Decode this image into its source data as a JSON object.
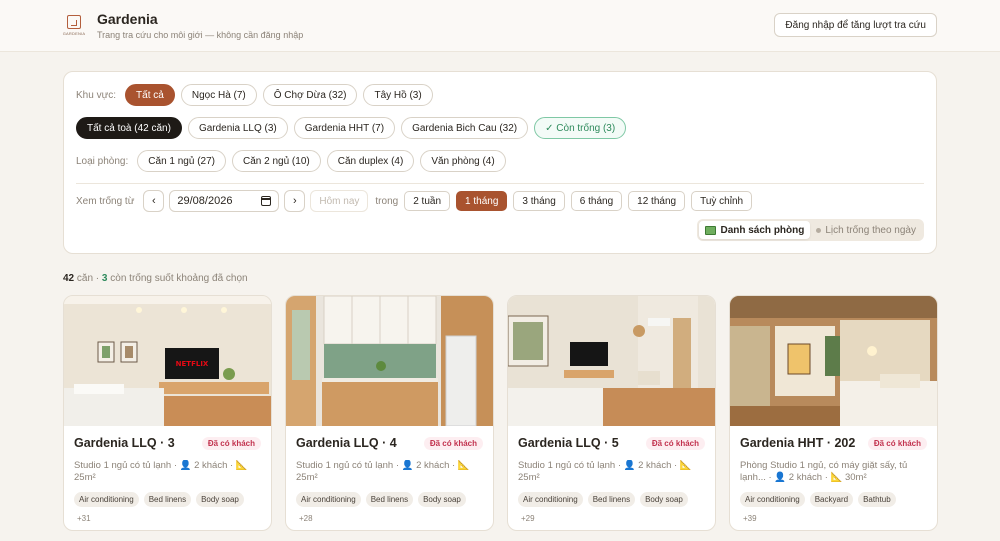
{
  "header": {
    "logo_text": "GARDENIA",
    "title": "Gardenia",
    "subtitle": "Trang tra cứu cho môi giới — không cần đăng nhập",
    "login_button": "Đăng nhập để tăng lượt tra cứu"
  },
  "filters": {
    "area_label": "Khu vực:",
    "areas": [
      "Tất cả",
      "Ngọc Hà (7)",
      "Ô Chợ Dừa (32)",
      "Tây Hồ (3)"
    ],
    "buildings": [
      "Tất cả toà (42 căn)",
      "Gardenia LLQ (3)",
      "Gardenia HHT (7)",
      "Gardenia Bich Cau (32)",
      "✓ Còn trống (3)"
    ],
    "room_type_label": "Loại phòng:",
    "room_types": [
      "Căn 1 ngủ (27)",
      "Căn 2 ngủ (10)",
      "Căn duplex (4)",
      "Văn phòng (4)"
    ],
    "availability_label": "Xem trống từ",
    "prev": "‹",
    "date": "29/08/2026",
    "next": "›",
    "today": "Hôm nay",
    "within": "trong",
    "durations": [
      "2 tuần",
      "1 tháng",
      "3 tháng",
      "6 tháng",
      "12 tháng",
      "Tuỳ chỉnh"
    ],
    "view_list": "Danh sách phòng",
    "view_calendar": "Lịch trống theo ngày"
  },
  "summary": {
    "total": "42",
    "total_suffix": " căn · ",
    "vacant": "3",
    "vacant_suffix": " còn trống suốt khoảng đã chọn"
  },
  "listings": [
    {
      "title": "Gardenia LLQ · 3",
      "badge": "Đã có khách",
      "desc": "Studio 1 ngủ có tủ lạnh · 👤 2 khách · 📐 25m²",
      "amenities": [
        "Air conditioning",
        "Bed linens",
        "Body soap"
      ],
      "more": "+31"
    },
    {
      "title": "Gardenia LLQ · 4",
      "badge": "Đã có khách",
      "desc": "Studio 1 ngủ có tủ lạnh · 👤 2 khách · 📐 25m²",
      "amenities": [
        "Air conditioning",
        "Bed linens",
        "Body soap"
      ],
      "more": "+28"
    },
    {
      "title": "Gardenia LLQ · 5",
      "badge": "Đã có khách",
      "desc": "Studio 1 ngủ có tủ lạnh · 👤 2 khách · 📐 25m²",
      "amenities": [
        "Air conditioning",
        "Bed linens",
        "Body soap"
      ],
      "more": "+29"
    },
    {
      "title": "Gardenia HHT · 202",
      "badge": "Đã có khách",
      "desc": "Phòng Studio 1 ngủ, có máy giặt sấy, tủ lạnh... · 👤 2 khách · 📐 30m²",
      "amenities": [
        "Air conditioning",
        "Backyard",
        "Bathtub"
      ],
      "more": "+39"
    }
  ],
  "photo_tv_text": "NETFLIX",
  "colors": {
    "accent": "#a9532f",
    "dark": "#1e1a16",
    "vacant_green": "#2e8a5c",
    "badge_red": "#c2334f"
  }
}
